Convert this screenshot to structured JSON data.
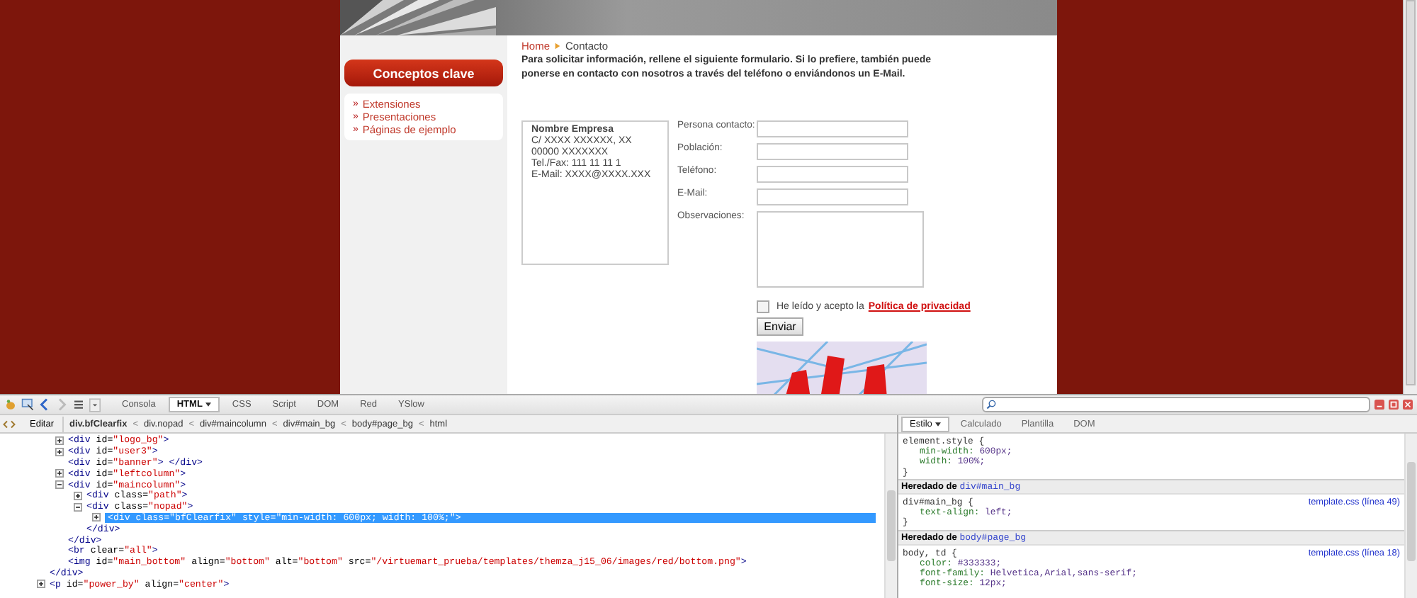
{
  "sidebar": {
    "title": "Conceptos clave",
    "links": [
      {
        "bullet": "»",
        "label": "Extensiones"
      },
      {
        "bullet": "»",
        "label": "Presentaciones"
      },
      {
        "bullet": "»",
        "label": "Páginas de ejemplo"
      }
    ]
  },
  "breadcrumb": [
    {
      "label": "Home",
      "link": true
    },
    {
      "label": "Contacto",
      "link": false
    }
  ],
  "intro": "Para solicitar información, rellene el siguiente formulario. Si lo prefiere, también puede ponerse en contacto con nosotros  a través del teléfono o enviándonos un E-Mail.",
  "company": {
    "name": "Nombre Empresa",
    "lines": [
      "C/ XXXX XXXXXX, XX",
      "00000 XXXXXXX",
      "Tel./Fax: 111 11 11 1",
      "E-Mail: XXXX@XXXX.XXX"
    ]
  },
  "form": {
    "fields": [
      {
        "label": "Persona contacto:",
        "kind": "input"
      },
      {
        "label": "Población:",
        "kind": "input"
      },
      {
        "label": "Teléfono:",
        "kind": "input"
      },
      {
        "label": "E-Mail:",
        "kind": "input"
      },
      {
        "label": "Observaciones:",
        "kind": "textarea"
      }
    ],
    "consent": {
      "text": "He leído y acepto la",
      "link": "Política de privacidad",
      "checked": false
    },
    "submit": "Enviar"
  },
  "devtools": {
    "tabs": [
      {
        "label": "Consola",
        "selected": false,
        "dropdown": false
      },
      {
        "label": "HTML",
        "selected": true,
        "dropdown": true
      },
      {
        "label": "CSS",
        "selected": false,
        "dropdown": false
      },
      {
        "label": "Script",
        "selected": false,
        "dropdown": false
      },
      {
        "label": "DOM",
        "selected": false,
        "dropdown": false
      },
      {
        "label": "Red",
        "selected": false,
        "dropdown": false
      },
      {
        "label": "YSlow",
        "selected": false,
        "dropdown": false
      }
    ],
    "edit": "Editar",
    "path": [
      {
        "label": "div.bfClearfix",
        "selected": true
      },
      {
        "separator": "<",
        "label": "div.nopad",
        "selected": false
      },
      {
        "separator": "<",
        "label": "div#maincolumn",
        "selected": false
      },
      {
        "separator": "<",
        "label": "div#main_bg",
        "selected": false
      },
      {
        "separator": "<",
        "label": "body#page_bg",
        "selected": false
      },
      {
        "separator": "<",
        "label": "html",
        "selected": false
      }
    ],
    "tree": [
      {
        "kind": "expanded",
        "close": "</div>",
        "children": [
          {
            "kind": "collapsed",
            "text": "<div id=\"logo_bg\">",
            "selected": false
          },
          {
            "kind": "collapsed",
            "text": "<div id=\"user3\">",
            "selected": false
          },
          {
            "kind": "leaf",
            "text": "<div id=\"banner\"> </div>",
            "selected": false
          },
          {
            "kind": "collapsed",
            "text": "<div id=\"leftcolumn\">",
            "selected": false
          },
          {
            "kind": "expanded",
            "text": "<div id=\"maincolumn\">",
            "selected": false,
            "close": "</div>",
            "children": [
              {
                "kind": "collapsed",
                "text": "<div class=\"path\">",
                "selected": false
              },
              {
                "kind": "expanded",
                "text": "<div class=\"nopad\">",
                "selected": false,
                "close": "</div>",
                "children": [
                  {
                    "kind": "collapsed",
                    "text": "<div class=\"bfClearfix\" style=\"min-width: 600px; width: 100%;\">",
                    "selected": true
                  }
                ]
              }
            ]
          },
          {
            "kind": "leaf",
            "text": "<br clear=\"all\">",
            "selected": false
          },
          {
            "kind": "leaf",
            "text": "<img id=\"main_bottom\" align=\"bottom\" alt=\"bottom\" src=\"/virtuemart_prueba/templates/themza_j15_06/images/red/bottom.png\">",
            "selected": false
          }
        ]
      },
      {
        "kind": "collapsed",
        "text": "<p id=\"power_by\" align=\"center\">",
        "selected": false
      }
    ],
    "style_tabs": [
      {
        "label": "Estilo",
        "selected": true,
        "dropdown": true
      },
      {
        "label": "Calculado",
        "selected": false,
        "dropdown": false
      },
      {
        "label": "Plantilla",
        "selected": false,
        "dropdown": false
      },
      {
        "label": "DOM",
        "selected": false,
        "dropdown": false
      }
    ],
    "css": [
      {
        "kind": "rule",
        "selector": "element.style {",
        "props": [
          "min-width: 600px;",
          "width: 100%;"
        ],
        "close": "}"
      },
      {
        "kind": "inherited",
        "label": "Heredado de",
        "element": "div#main_bg"
      },
      {
        "kind": "rule",
        "selector": "div#main_bg {",
        "source": "template.css (línea 49)",
        "props": [
          "text-align: left;"
        ],
        "close": "}"
      },
      {
        "kind": "inherited",
        "label": "Heredado de",
        "element": "body#page_bg"
      },
      {
        "kind": "rule",
        "selector": "body, td {",
        "source": "template.css (línea 18)",
        "props": [
          "color: #333333;",
          "font-family: Helvetica,Arial,sans-serif;",
          "font-size: 12px;"
        ]
      }
    ]
  }
}
